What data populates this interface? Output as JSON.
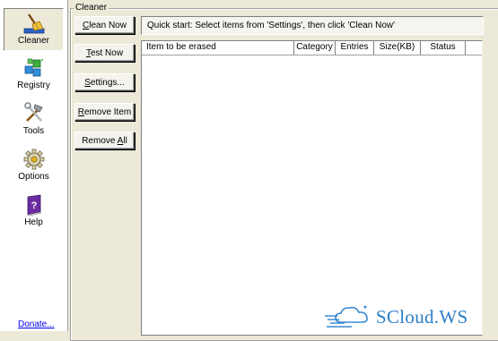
{
  "nav": {
    "items": [
      {
        "label": "Cleaner",
        "icon": "broom-icon",
        "active": true
      },
      {
        "label": "Registry",
        "icon": "cubes-icon"
      },
      {
        "label": "Tools",
        "icon": "tools-icon"
      },
      {
        "label": "Options",
        "icon": "gear-icon"
      },
      {
        "label": "Help",
        "icon": "help-book-icon"
      }
    ],
    "donate": "Donate..."
  },
  "group": {
    "title": "Cleaner"
  },
  "buttons": {
    "clean_now_pre": "",
    "clean_now_key": "C",
    "clean_now_post": "lean Now",
    "test_now_pre": "",
    "test_now_key": "T",
    "test_now_post": "est Now",
    "settings_pre": "",
    "settings_key": "S",
    "settings_post": "ettings...",
    "remove_item_pre": "",
    "remove_item_key": "R",
    "remove_item_post": "emove Item",
    "remove_all_pre": "Remove ",
    "remove_all_key": "A",
    "remove_all_post": "ll"
  },
  "quickstart": {
    "text": "Quick start: Select items from 'Settings', then click 'Clean Now'"
  },
  "list": {
    "columns": [
      "Item to be erased",
      "Category",
      "Entries",
      "Size(KB)",
      "Status"
    ],
    "rows": []
  },
  "watermark": {
    "text": "SCloud.WS"
  },
  "colors": {
    "window_bg": "#ece9d8",
    "nav_bg": "#ffffff",
    "link": "#0000ee",
    "watermark": "#2a7ec8"
  }
}
